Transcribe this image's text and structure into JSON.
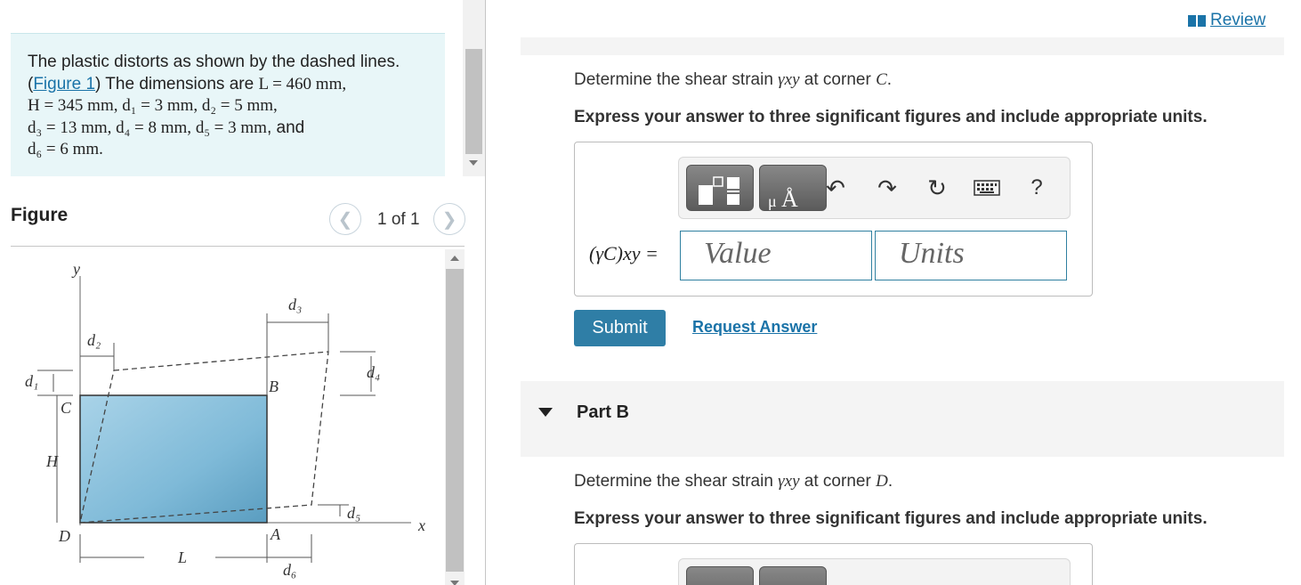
{
  "problem": {
    "text_before_link": "The plastic distorts as shown by the dashed lines. (",
    "link_text": "Figure 1",
    "text_after_link": ") The dimensions are ",
    "L": "L = 460 mm,",
    "H": "H = 345 mm, ",
    "d1": "d₁ = 3 mm, ",
    "d2": "d₂ = 5 mm,",
    "d3": "d₃ = 13 mm, ",
    "d4": "d₄ = 8 mm, ",
    "d5": "d₅ = 3 mm",
    "and": ", and",
    "d6": "d₆ = 6 mm."
  },
  "figure": {
    "title": "Figure",
    "counter": "1 of 1",
    "prev_icon": "chevron-left-icon",
    "next_icon": "chevron-right-icon",
    "labels": {
      "y": "y",
      "x": "x",
      "C": "C",
      "B": "B",
      "D": "D",
      "A": "A",
      "H": "H",
      "L": "L",
      "d1": "d₁",
      "d2": "d₂",
      "d3": "d₃",
      "d4": "d₄",
      "d5": "d₅",
      "d6": "d₆"
    }
  },
  "header": {
    "review_label": "Review",
    "review_icon": "book-icon"
  },
  "partA": {
    "question_prefix": "Determine the shear strain ",
    "question_symbol": "γxy",
    "question_suffix": " at corner ",
    "corner": "C",
    "period": ".",
    "instruction": "Express your answer to three significant figures and include appropriate units.",
    "equation_label": "(γC)xy =",
    "value_placeholder": "Value",
    "units_placeholder": "Units",
    "submit_label": "Submit",
    "request_label": "Request Answer",
    "toolbar": {
      "templates_icon": "fraction-template-icon",
      "units_icon": "units-angstrom-icon",
      "undo_icon": "undo-icon",
      "redo_icon": "redo-icon",
      "reset_icon": "reset-icon",
      "keyboard_icon": "keyboard-icon",
      "help_label": "?"
    }
  },
  "partB": {
    "title": "Part B",
    "question_prefix": "Determine the shear strain ",
    "question_symbol": "γxy",
    "question_suffix": " at corner ",
    "corner": "D",
    "period": ".",
    "instruction": "Express your answer to three significant figures and include appropriate units."
  },
  "colors": {
    "accent": "#2f7ea6",
    "link": "#1a73a8",
    "problem_bg": "#e8f6f8",
    "plate_fill": "#7fbad8"
  }
}
